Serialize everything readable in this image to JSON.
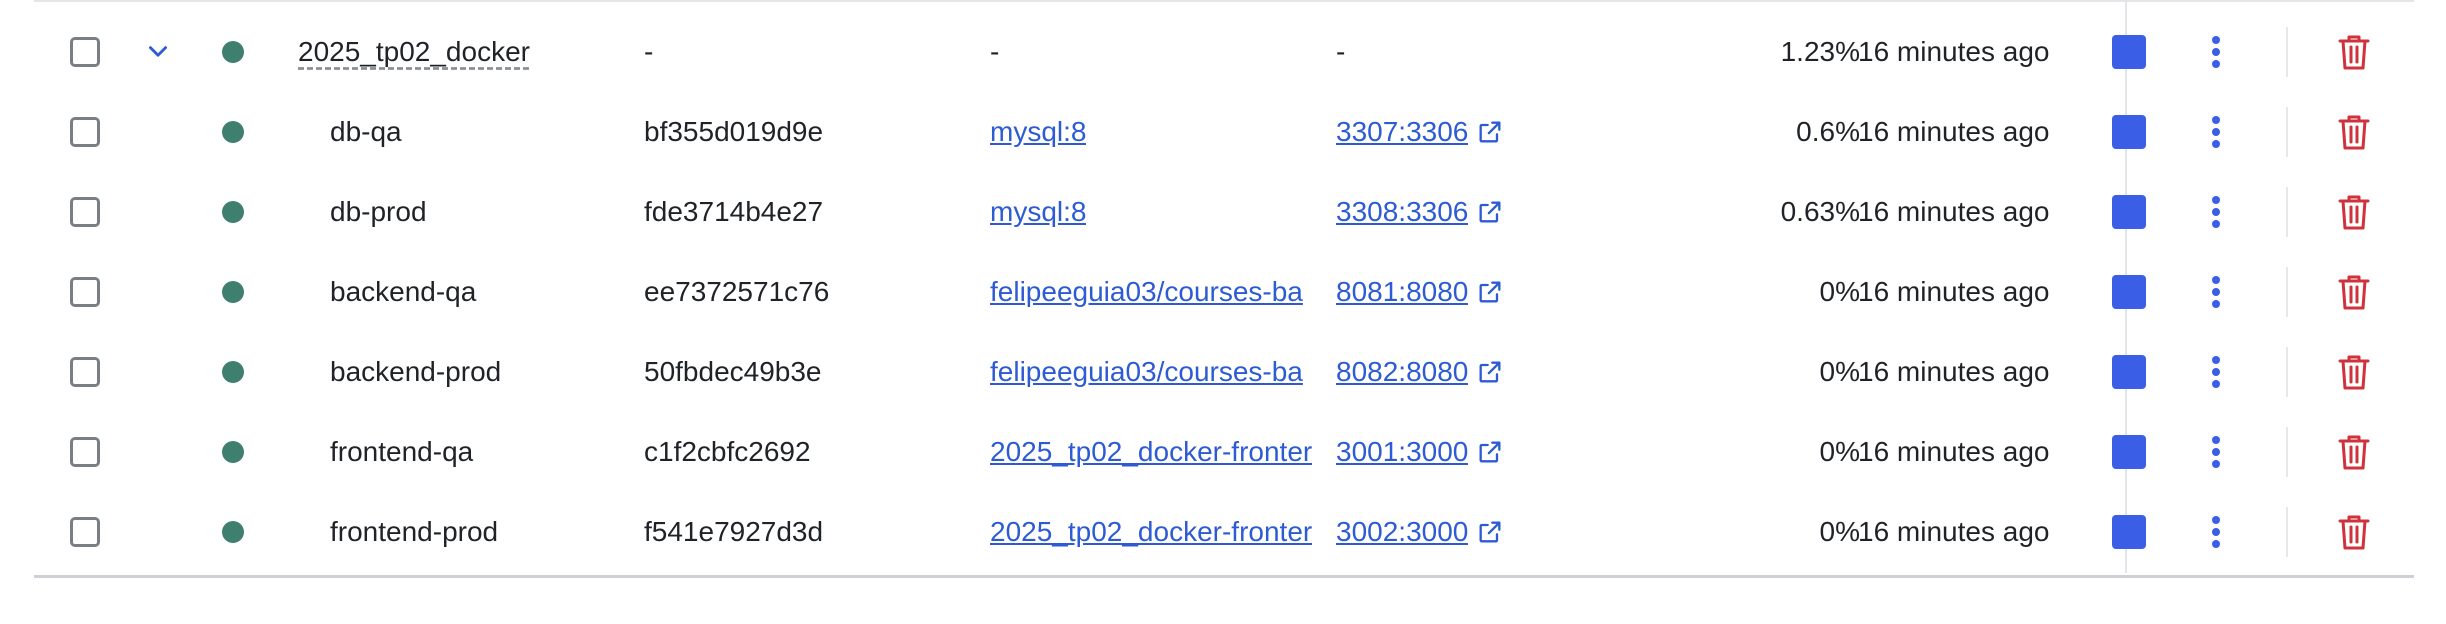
{
  "colors": {
    "status_running": "#3e7f6f",
    "accent": "#3a5ee6",
    "link": "#2d5bd3",
    "danger": "#d0323b"
  },
  "group": {
    "name": "2025_tp02_docker",
    "container_id": "-",
    "image": "-",
    "port": "-",
    "cpu": "1.23%",
    "last_started": "16 minutes ago"
  },
  "containers": [
    {
      "name": "db-qa",
      "container_id": "bf355d019d9e",
      "image": "mysql:8",
      "port": "3307:3306",
      "cpu": "0.6%",
      "last_started": "16 minutes ago"
    },
    {
      "name": "db-prod",
      "container_id": "fde3714b4e27",
      "image": "mysql:8",
      "port": "3308:3306",
      "cpu": "0.63%",
      "last_started": "16 minutes ago"
    },
    {
      "name": "backend-qa",
      "container_id": "ee7372571c76",
      "image": "felipeeguia03/courses-ba",
      "port": "8081:8080",
      "cpu": "0%",
      "last_started": "16 minutes ago"
    },
    {
      "name": "backend-prod",
      "container_id": "50fbdec49b3e",
      "image": "felipeeguia03/courses-ba",
      "port": "8082:8080",
      "cpu": "0%",
      "last_started": "16 minutes ago"
    },
    {
      "name": "frontend-qa",
      "container_id": "c1f2cbfc2692",
      "image": "2025_tp02_docker-fronter",
      "port": "3001:3000",
      "cpu": "0%",
      "last_started": "16 minutes ago"
    },
    {
      "name": "frontend-prod",
      "container_id": "f541e7927d3d",
      "image": "2025_tp02_docker-fronter",
      "port": "3002:3000",
      "cpu": "0%",
      "last_started": "16 minutes ago"
    }
  ],
  "icons": {
    "expand": "chevron-down-icon",
    "status": "status-dot-icon",
    "stop": "stop-icon",
    "more": "more-vertical-icon",
    "delete": "trash-icon",
    "external": "external-link-icon"
  }
}
